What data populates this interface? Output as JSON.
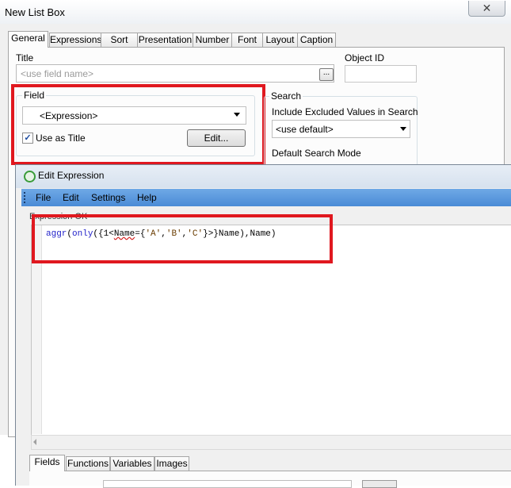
{
  "outer_dialog": {
    "title": "New List Box",
    "close_glyph": "✕",
    "tabs": [
      "General",
      "Expressions",
      "Sort",
      "Presentation",
      "Number",
      "Font",
      "Layout",
      "Caption"
    ],
    "active_tab": "General",
    "title_field": {
      "label": "Title",
      "placeholder": "<use field name>",
      "browse_label": "..."
    },
    "object_id": {
      "label": "Object ID",
      "value": ""
    },
    "field_group": {
      "legend": "Field",
      "selected": "<Expression>",
      "use_as_title_label": "Use as Title",
      "use_as_title_checked": true,
      "check_glyph": "✓",
      "edit_button": "Edit..."
    },
    "search_group": {
      "legend": "Search",
      "excluded_label": "Include Excluded Values in Search",
      "excluded_selected": "<use default>",
      "search_mode_label": "Default Search Mode"
    }
  },
  "edit_dialog": {
    "title": "Edit Expression",
    "icon": "qlikview-icon",
    "menu": [
      "File",
      "Edit",
      "Settings",
      "Help"
    ],
    "expression_label": "Expression OK",
    "expression_parts": {
      "fn1": "aggr",
      "p1": "(",
      "fn2": "only",
      "p2": "({1<",
      "field": "Name",
      "p3": "={",
      "s1": "'A'",
      "c1": ",",
      "s2": "'B'",
      "c2": ",",
      "s3": "'C'",
      "p4": "}>}Name),Name)"
    },
    "bottom_tabs": [
      "Fields",
      "Functions",
      "Variables",
      "Images"
    ],
    "active_bottom_tab": "Fields"
  },
  "annotations": {
    "highlight_color": "#e0181f"
  }
}
